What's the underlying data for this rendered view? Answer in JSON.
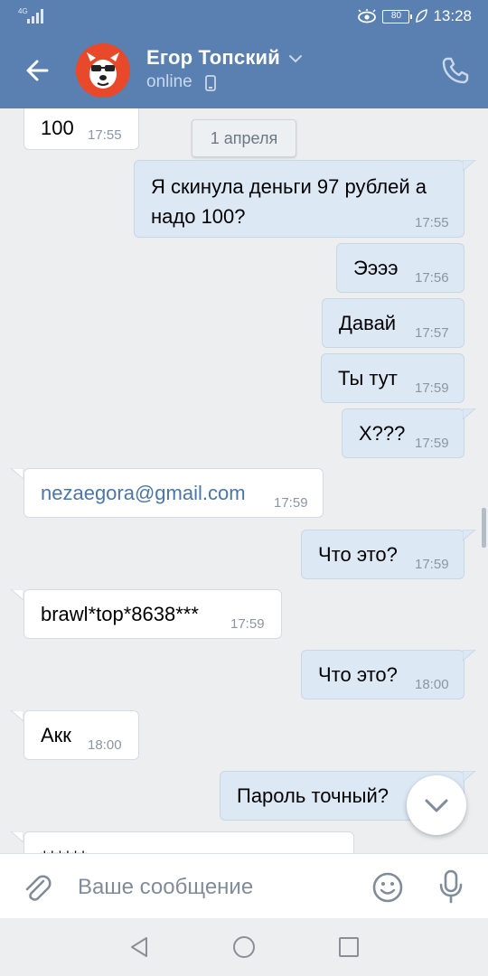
{
  "statusbar": {
    "network": "4G",
    "battery": "80",
    "time": "13:28"
  },
  "header": {
    "name": "Егор Топский",
    "status": "online"
  },
  "date_divider": "1 апреля",
  "messages": [
    {
      "dir": "in",
      "text": "100",
      "time": "17:55"
    },
    {
      "dir": "out",
      "line1": "Я скинула деньги 97 рублей а",
      "line2": "надо 100?",
      "time": "17:55"
    },
    {
      "dir": "out",
      "text": "Ээээ",
      "time": "17:56"
    },
    {
      "dir": "out",
      "text": "Давай",
      "time": "17:57"
    },
    {
      "dir": "out",
      "text": "Ты тут",
      "time": "17:59"
    },
    {
      "dir": "out",
      "text": "Х???",
      "time": "17:59"
    },
    {
      "dir": "in",
      "text": "nezaegora@gmail.com",
      "time": "17:59"
    },
    {
      "dir": "out",
      "text": "Что это?",
      "time": "17:59"
    },
    {
      "dir": "in",
      "text": "brawl*top*8638***",
      "time": "17:59"
    },
    {
      "dir": "out",
      "text": "Что это?",
      "time": "18:00"
    },
    {
      "dir": "in",
      "text": "Акк",
      "time": "18:00"
    },
    {
      "dir": "out",
      "text": "Пароль точный?",
      "time": ""
    },
    {
      "dir": "in",
      "text": "******",
      "time": ""
    }
  ],
  "composer": {
    "placeholder": "Ваше сообщение"
  },
  "colors": {
    "header": "#5a80b1",
    "outgoing": "#dde8f5",
    "incoming": "#ffffff",
    "link": "#4a76a8"
  }
}
